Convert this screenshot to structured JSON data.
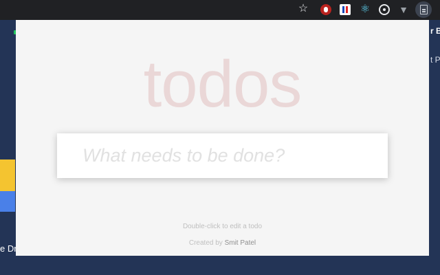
{
  "browser": {
    "extension_icons": [
      "bookmark-star-icon",
      "adblock-icon",
      "flag-extension-icon",
      "react-icon",
      "target-icon",
      "vue-icon",
      "document-extension-icon"
    ]
  },
  "background_page": {
    "right_text_1": "r Be",
    "right_text_2": "t Pa",
    "left_text": "e Dr"
  },
  "app": {
    "title": "todos",
    "new_todo_placeholder": "What needs to be done?",
    "new_todo_value": "",
    "hint": "Double-click to edit a todo",
    "credit_prefix": "Created by",
    "credit_author": "Smit Patel"
  },
  "colors": {
    "title": "#af2f2f",
    "background": "#f5f5f5",
    "page_bg": "#233456"
  }
}
